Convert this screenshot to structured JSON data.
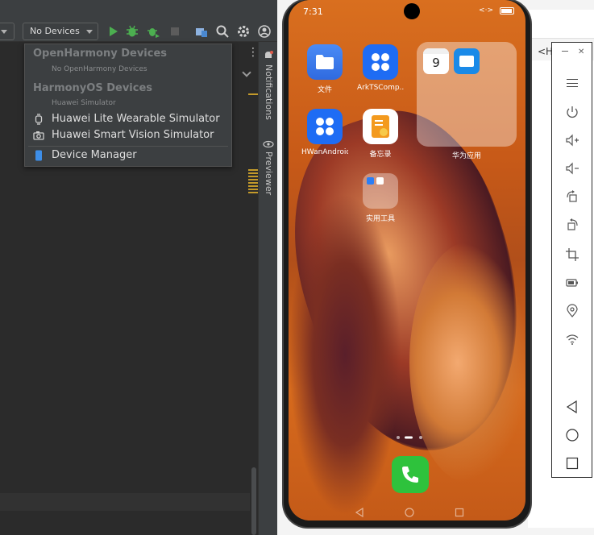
{
  "ide": {
    "device_select": "No Devices",
    "popup": {
      "open_harmony_heading": "OpenHarmony Devices",
      "open_harmony_sub": "No OpenHarmony Devices",
      "harmony_os_heading": "HarmonyOS Devices",
      "harmony_os_sub": "Huawei Simulator",
      "wearable": "Huawei Lite Wearable Simulator",
      "smart_vision": "Huawei Smart Vision Simulator",
      "device_manager": "Device Manager"
    },
    "side_tabs": {
      "notifications": "Notifications",
      "previewer": "Previewer"
    }
  },
  "phone": {
    "time": "7:31",
    "status_icons": "<·>",
    "apps": {
      "files": "文件",
      "arkts": "ArkTSComp...",
      "calendar_date": "9",
      "huawei_apps_folder": "华为应用",
      "hwan": "HWanAndroid",
      "memo": "备忘录",
      "tools_folder": "实用工具"
    }
  },
  "background_window": {
    "tab_label": "<Ha"
  },
  "colors": {
    "ide_bg": "#2b2b2b",
    "ide_toolbar": "#3c3f41",
    "run_green": "#4caf50",
    "device_manager_blue": "#3d8ee8",
    "phone_green": "#2ec23c",
    "app_blue": "#1e6cf4"
  }
}
